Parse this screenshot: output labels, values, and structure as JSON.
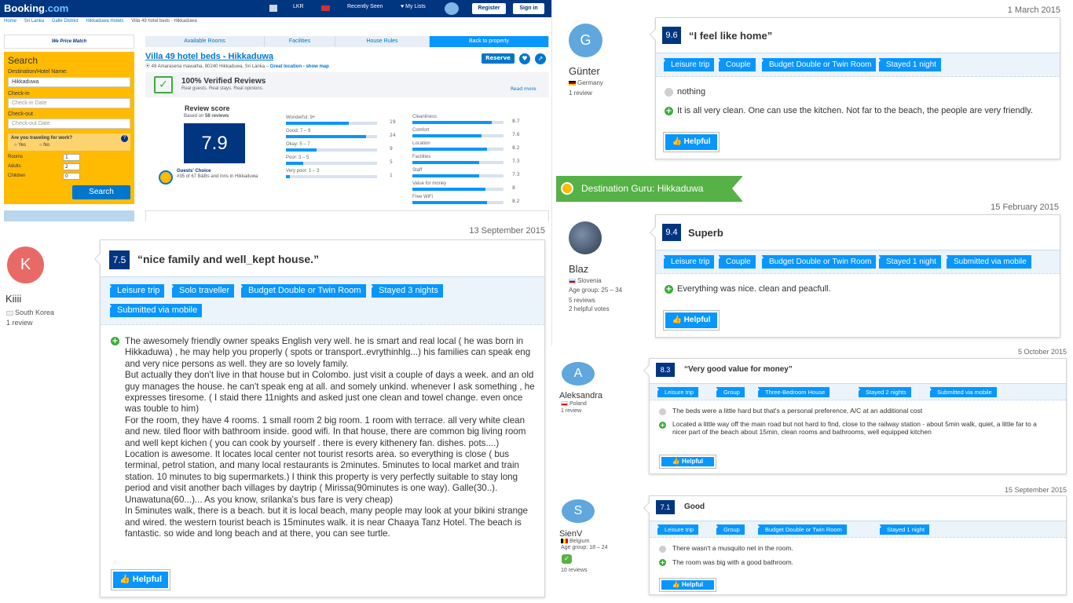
{
  "booking": {
    "logo": "Booking",
    "logo_dotcom": ".com",
    "currency": "LKR",
    "recently_seen": "Recently Seen",
    "my_lists": "My Lists",
    "register": "Register",
    "sign_in": "Sign in",
    "breadcrumbs": [
      "Home",
      "Sri Lanka",
      "Galle District",
      "Hikkaduwa Hotels",
      "Villa 49 hotel beds - Hikkaduwa"
    ],
    "price_match": "We Price Match",
    "search": {
      "heading": "Search",
      "dest_label": "Destination/Hotel Name:",
      "dest_value": "Hikkaduwa",
      "checkin_label": "Check-in",
      "checkin_placeholder": "Check-in Date",
      "checkout_label": "Check-out",
      "checkout_placeholder": "Check-out Date",
      "work_question": "Are you traveling for work?",
      "yes": "Yes",
      "no": "No",
      "rooms_label": "Rooms",
      "rooms_value": "1",
      "adults_label": "Adults",
      "adults_value": "2",
      "children_label": "Children",
      "children_value": "0",
      "button": "Search"
    },
    "tabs": [
      "Available Rooms",
      "Facilities",
      "House Rules",
      "Back to property"
    ],
    "hotel_name": "Villa 49 hotel beds - Hikkaduwa",
    "address": "49 Amarasena mawatha, 80240 Hikkaduwa, Sri Lanka –",
    "address_link": "Great location - show map",
    "reserve": "Reserve",
    "verified_title": "100% Verified Reviews",
    "verified_sub": "Real guests. Real stays. Real opinions.",
    "read_more": "Read more",
    "review_score_title": "Review score",
    "review_score_sub_pre": "Based on",
    "review_score_count": "58 reviews",
    "review_score": "7.9",
    "guests_choice_title": "Guests' Choice",
    "guests_choice_text": "#35 of 67 B&Bs and inns in Hikkaduwa",
    "distribution": [
      {
        "label": "Wonderful: 9+",
        "count": "19",
        "fraction": 0.33
      },
      {
        "label": "Good: 7 – 9",
        "count": "24",
        "fraction": 0.42
      },
      {
        "label": "Okay: 5 – 7",
        "count": "9",
        "fraction": 0.16
      },
      {
        "label": "Poor: 3 – 5",
        "count": "5",
        "fraction": 0.09
      },
      {
        "label": "Very poor: 1 – 3",
        "count": "1",
        "fraction": 0.02
      }
    ],
    "categories": [
      {
        "label": "Cleanliness",
        "score": "8.7"
      },
      {
        "label": "Comfort",
        "score": "7.6"
      },
      {
        "label": "Location",
        "score": "8.2"
      },
      {
        "label": "Facilities",
        "score": "7.3"
      },
      {
        "label": "Staff",
        "score": "7.3"
      },
      {
        "label": "Value for money",
        "score": "8"
      },
      {
        "label": "Free WiFi",
        "score": "8.2"
      }
    ]
  },
  "guru_badge": "Destination Guru: Hikkaduwa",
  "reviews": {
    "kiiii": {
      "date": "13 September 2015",
      "initial": "K",
      "name": "Kiiii",
      "country": "South Korea",
      "meta": "1 review",
      "score": "7.5",
      "title": "“nice family and well_kept house.”",
      "tags": [
        "Leisure trip",
        "Solo traveller",
        "Budget Double or Twin Room",
        "Stayed 3 nights",
        "Submitted via mobile"
      ],
      "positive": "The awesomely friendly owner speaks English very well. he is smart and real local ( he was born in Hikkaduwa) , he may help you properly ( spots or transport..evrythinhlg...)  his families can speak eng and very nice persons as well.  they are so lovely family.\nBut actually they don't live in that house but in Colombo.  just visit a couple of days a week. and an old guy manages the house.  he can't speak eng at all. and somely unkind. whenever I ask something , he expresses tiresome. ( I staid there 11nights and asked just one clean and towel change. even once was touble to him)\nFor the room, they have 4 rooms. 1 small room 2 big room. 1 room with terrace. all very white clean and new. tiled floor with bathroom inside. good wifi.  In that house, there are common big living room and well kept kichen ( you can cook by yourself  . there is every kithenery fan. dishes. pots....)\nLocation is awesome. It locates local center not tourist resorts area. so everything is close ( bus terminal, petrol station, and many local restaurants is 2minutes. 5minutes to local market and train station. 10 minutes to big supermarkets.) I think this property is very perfectly suitable to stay long period and visit another bach villages by daytrip ( Mirissa(90minutes is one way). Galle(30..). Unawatuna(60...)... As you know, srilanka's bus fare is very cheap)\nIn 5minutes walk, there is a beach. but it is local beach,  many people may look at your bikini strange and wired. the western tourist beach is 15minutes walk. it is near Chaaya Tanz Hotel. The beach is fantastic. so wide and long beach and at there, you can see turtle.",
      "helpful": "Helpful"
    },
    "gunter": {
      "date": "1 March 2015",
      "initial": "G",
      "name": "Günter",
      "country": "Germany",
      "meta": "1 review",
      "score": "9.6",
      "title": "“I feel like home”",
      "tags": [
        "Leisure trip",
        "Couple",
        "Budget Double or Twin Room",
        "Stayed 1 night"
      ],
      "negative": "nothing",
      "positive": "It is all very clean. One can use the kitchen. Not far to the beach, the people are very friendly.",
      "helpful": "Helpful"
    },
    "blaz": {
      "date": "15 February 2015",
      "name": "Blaz",
      "country": "Slovenia",
      "age": "Age group: 25 – 34",
      "meta1": "5 reviews",
      "meta2": "2 helpful votes",
      "score": "9.4",
      "title": "Superb",
      "tags": [
        "Leisure trip",
        "Couple",
        "Budget Double or Twin Room",
        "Stayed 1 night",
        "Submitted via mobile"
      ],
      "positive": "Everything was nice. clean and peacfull.",
      "helpful": "Helpful"
    },
    "aleksandra": {
      "date": "5 October 2015",
      "initial": "A",
      "name": "Aleksandra",
      "country": "Poland",
      "meta": "1 review",
      "score": "8.3",
      "title": "“Very good value for money”",
      "tags": [
        "Leisure trip",
        "Group",
        "Three-Bedroom House",
        "Stayed 2 nights",
        "Submitted via mobile"
      ],
      "negative": "The beds were a little hard but that's a personal preference, A/C at an additional cost",
      "positive": "Located a little way off the main road but not hard to find, close to the railway station - about 5min walk, quiet, a little far to a nicer part of the beach about 15min, clean rooms and bathrooms, well equipped kitchen",
      "helpful": "Helpful"
    },
    "sienv": {
      "date": "15 September 2015",
      "initial": "S",
      "name": "SienV",
      "country": "Belgium",
      "age": "Age group: 18 – 24",
      "meta": "10 reviews",
      "score": "7.1",
      "title": "Good",
      "tags": [
        "Leisure trip",
        "Group",
        "Budget Double or Twin Room",
        "Stayed 1 night"
      ],
      "negative": "There wasn't a musquito net in the room.",
      "positive": "The room was big with a good bathroom.",
      "helpful": "Helpful"
    }
  }
}
